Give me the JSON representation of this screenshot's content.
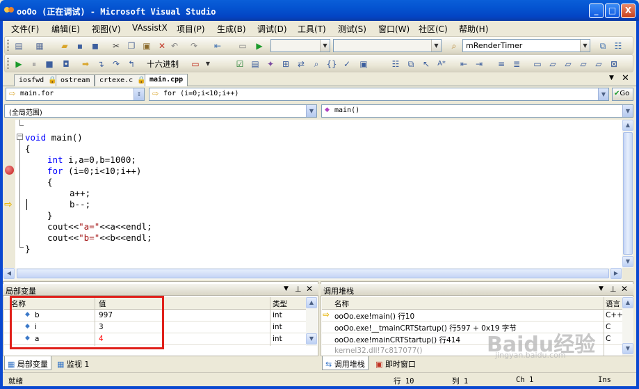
{
  "window": {
    "title": "ooOo (正在调试) - Microsoft Visual Studio",
    "min": "_",
    "max": "□",
    "close": "X"
  },
  "menu": [
    "文件(F)",
    "编辑(E)",
    "视图(V)",
    "VAssistX",
    "项目(P)",
    "生成(B)",
    "调试(D)",
    "工具(T)",
    "测试(S)",
    "窗口(W)",
    "社区(C)",
    "帮助(H)"
  ],
  "toolbar": {
    "find_combo_value": "mRenderTimer",
    "hex_label": "十六进制"
  },
  "tabs": [
    "iosfwd",
    "ostream",
    "crtexe.c",
    "main.cpp"
  ],
  "active_tab": "main.cpp",
  "nav": {
    "file_combo": "main.for",
    "scope_combo": "for (i=0;i<10;i++)",
    "go_label": "Go",
    "global_scope": "(全局范围)",
    "member_combo": "main()"
  },
  "code": [
    "void main()",
    "{",
    "int i,a=0,b=1000;",
    "for (i=0;i<10;i++)",
    "{",
    "a++;",
    "b--;",
    "}",
    "cout<<\"a=\"<<a<<endl;",
    "cout<<\"b=\"<<b<<endl;",
    "}"
  ],
  "locals": {
    "title": "局部变量",
    "columns": [
      "名称",
      "值",
      "类型"
    ],
    "rows": [
      {
        "name": "b",
        "value": "997",
        "type": "int",
        "changed": false
      },
      {
        "name": "i",
        "value": "3",
        "type": "int",
        "changed": false
      },
      {
        "name": "a",
        "value": "4",
        "type": "int",
        "changed": true
      }
    ],
    "tabs": [
      "局部变量",
      "监视 1"
    ]
  },
  "callstack": {
    "title": "调用堆栈",
    "columns": [
      "名称",
      "语言"
    ],
    "rows": [
      {
        "name": "ooOo.exe!main() 行10",
        "lang": "C++",
        "current": true
      },
      {
        "name": "ooOo.exe!__tmainCRTStartup() 行597 + 0x19 字节",
        "lang": "C",
        "current": false
      },
      {
        "name": "ooOo.exe!mainCRTStartup() 行414",
        "lang": "C",
        "current": false
      },
      {
        "name": "kernel32.dll!7c817077()",
        "lang": "",
        "current": false
      }
    ],
    "tabs": [
      "调用堆栈",
      "即时窗口"
    ]
  },
  "status": {
    "ready": "就绪",
    "line": "行 10",
    "col": "列 1",
    "ch": "Ch 1",
    "mode": "Ins"
  },
  "watermark": {
    "brand": "Baidu经验",
    "url": "jingyan.baidu.com"
  },
  "colors": {
    "accent": "#0a48d0",
    "highlight_box": "#e0201a",
    "changed_value": "#ff0000"
  }
}
